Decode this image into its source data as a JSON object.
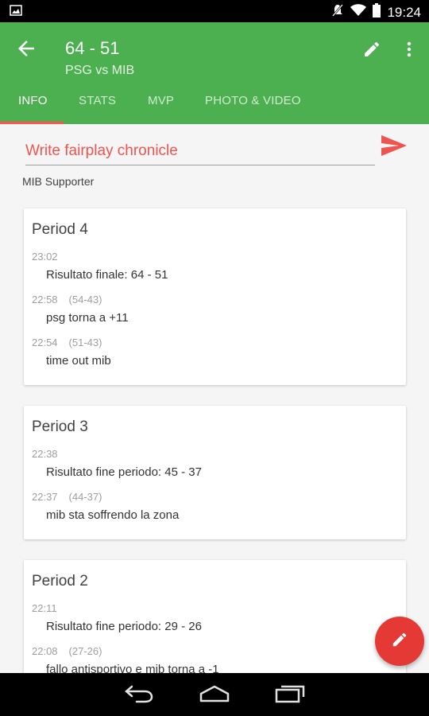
{
  "status_bar": {
    "time": "19:24",
    "left_icon": "image-icon",
    "right_icons": [
      "mute-icon",
      "wifi-icon",
      "battery-icon"
    ]
  },
  "app_bar": {
    "score": "64 - 51",
    "teams": "PSG vs MIB",
    "color": "#4caf50"
  },
  "tabs": [
    {
      "label": "INFO",
      "active": true
    },
    {
      "label": "STATS",
      "active": false
    },
    {
      "label": "MVP",
      "active": false
    },
    {
      "label": "PHOTO & VIDEO",
      "active": false
    }
  ],
  "chronicle": {
    "placeholder": "Write fairplay chronicle",
    "supporter": "MIB Supporter"
  },
  "periods": [
    {
      "title": "Period 4",
      "entries": [
        {
          "time": "23:02",
          "score": "",
          "text": "Risultato finale: 64 - 51"
        },
        {
          "time": "22:58",
          "score": "(54-43)",
          "text": "psg torna a +11"
        },
        {
          "time": "22:54",
          "score": "(51-43)",
          "text": "time out mib"
        }
      ]
    },
    {
      "title": "Period 3",
      "entries": [
        {
          "time": "22:38",
          "score": "",
          "text": "Risultato fine periodo: 45 - 37"
        },
        {
          "time": "22:37",
          "score": "(44-37)",
          "text": "mib sta soffrendo la zona"
        }
      ]
    },
    {
      "title": "Period 2",
      "entries": [
        {
          "time": "22:11",
          "score": "",
          "text": "Risultato fine periodo: 29 - 26"
        },
        {
          "time": "22:08",
          "score": "(27-26)",
          "text": "fallo antisportivo e mib torna a -1"
        }
      ]
    }
  ],
  "colors": {
    "accent_red": "#e53935",
    "placeholder_red": "#ef5350"
  }
}
